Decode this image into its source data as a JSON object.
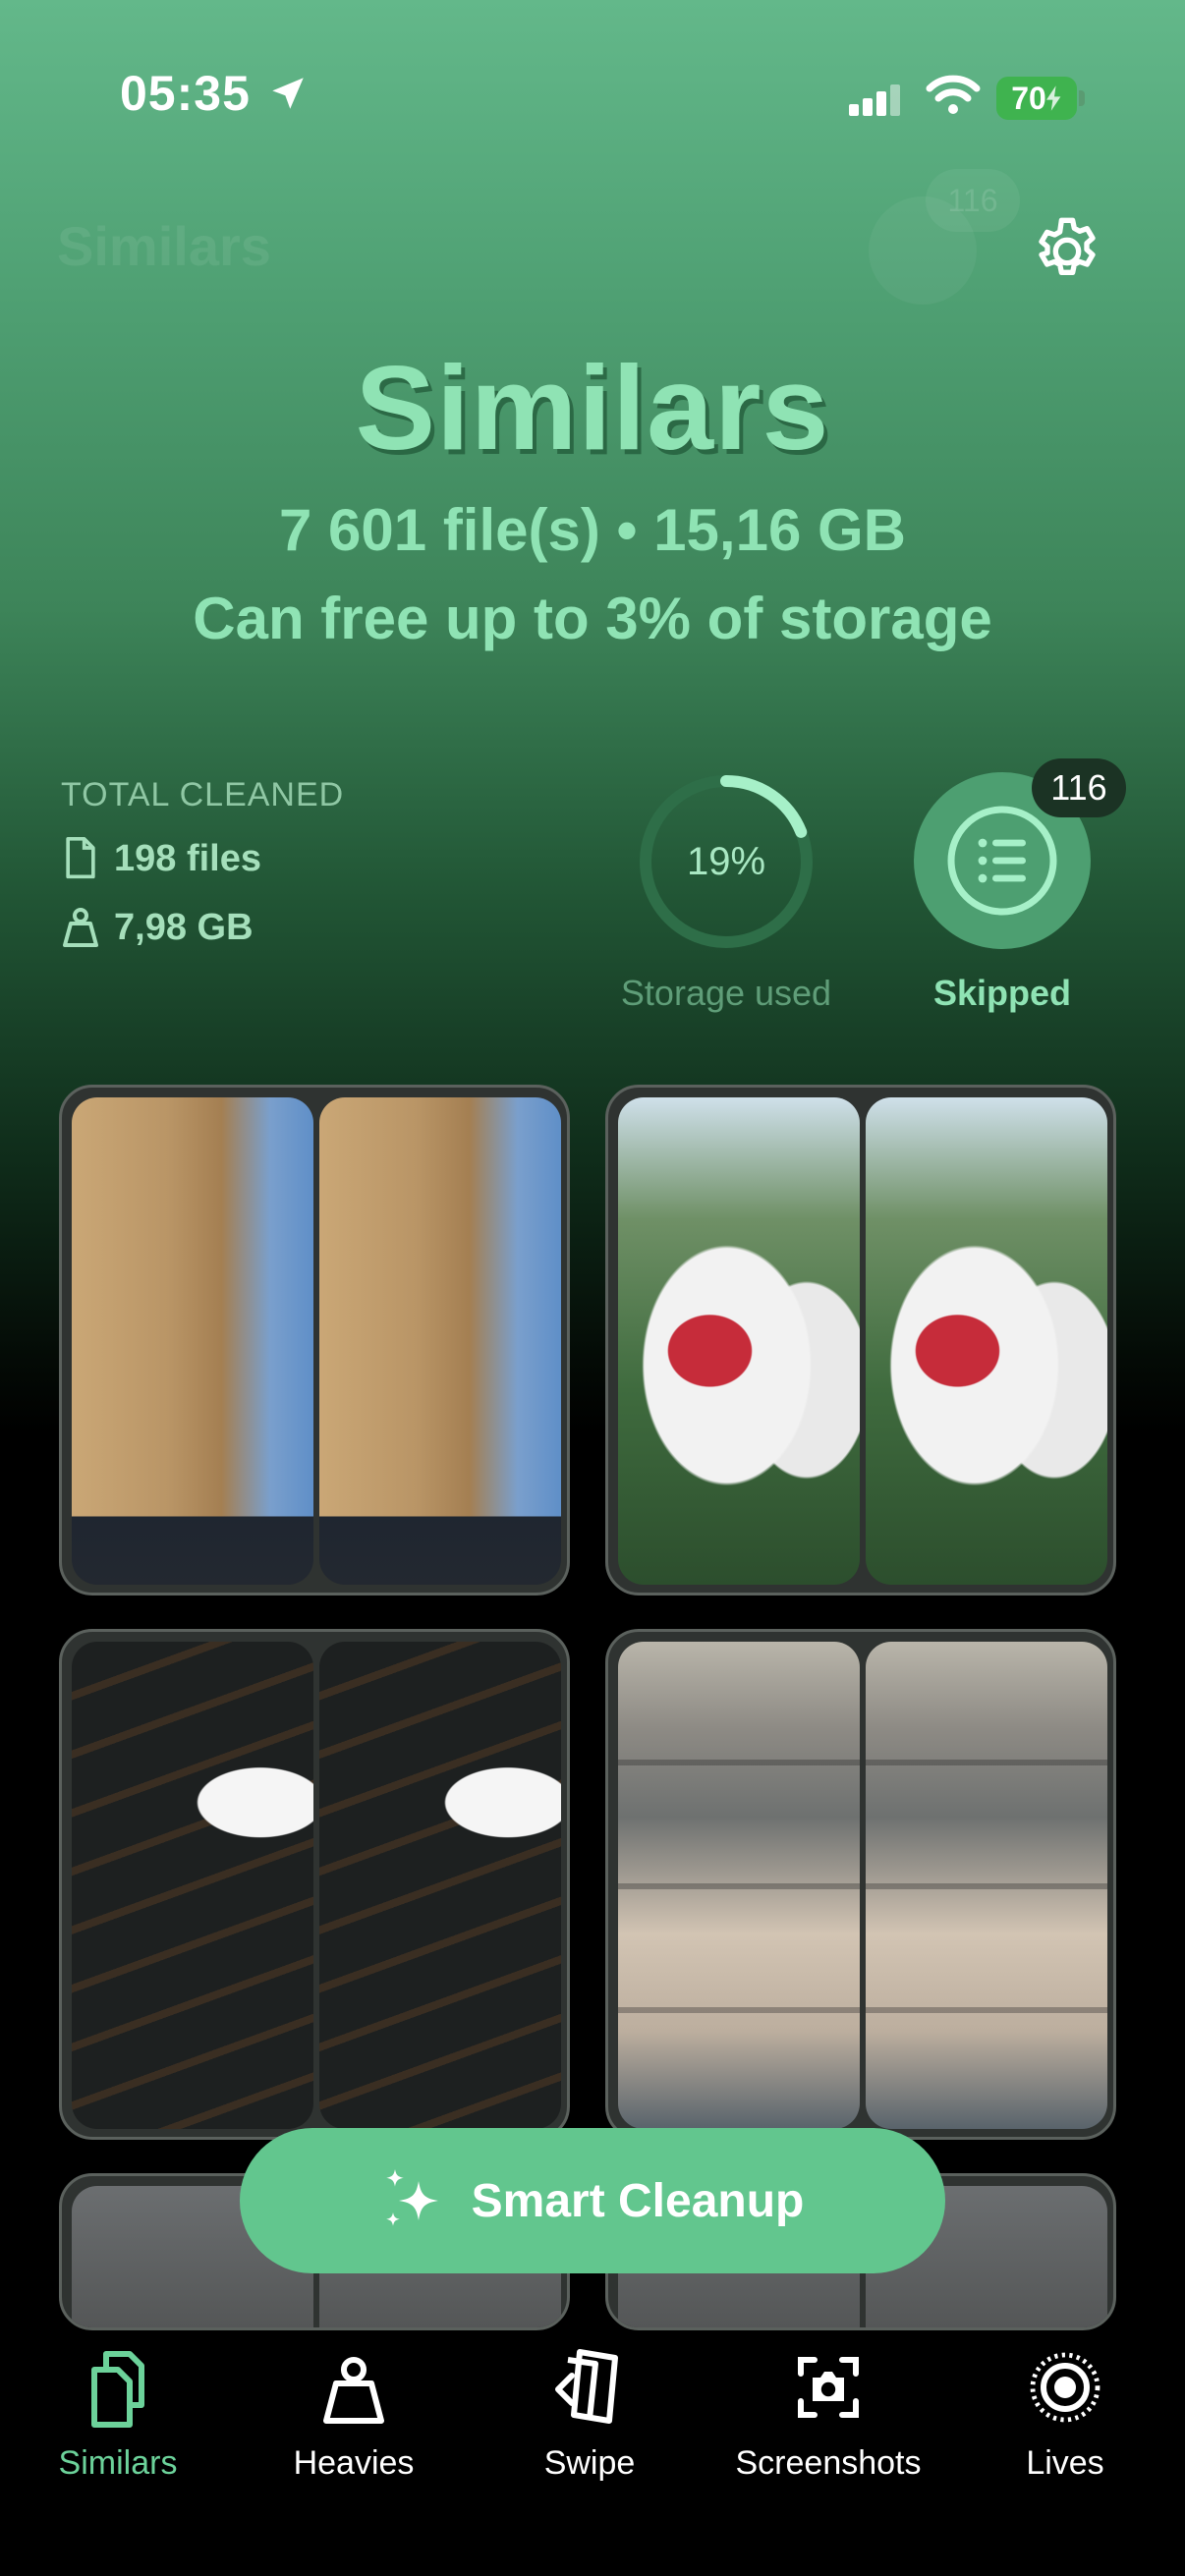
{
  "status_bar": {
    "time": "05:35",
    "battery": "70"
  },
  "header": {
    "ghost_title": "Similars",
    "ghost_badge": "116"
  },
  "hero": {
    "title": "Similars",
    "files_summary": "7 601 file(s) • 15,16 GB",
    "free_up": "Can free up to 3% of storage"
  },
  "total_cleaned": {
    "label": "TOTAL CLEANED",
    "files": "198 files",
    "size": "7,98 GB"
  },
  "storage": {
    "percent_text": "19%",
    "fraction": 0.19,
    "label": "Storage used"
  },
  "skipped": {
    "count": "116",
    "label": "Skipped"
  },
  "grid": {
    "items": [
      {
        "name": "arc-de-triomphe-pair"
      },
      {
        "name": "korean-flag-pair"
      },
      {
        "name": "kimbap-pair"
      },
      {
        "name": "building-window-pair"
      }
    ]
  },
  "cleanup": {
    "label": "Smart Cleanup"
  },
  "tabs": [
    {
      "label": "Similars",
      "icon": "documents-icon",
      "active": true
    },
    {
      "label": "Heavies",
      "icon": "weight-icon",
      "active": false
    },
    {
      "label": "Swipe",
      "icon": "swipe-cards-icon",
      "active": false
    },
    {
      "label": "Screenshots",
      "icon": "screenshot-camera-icon",
      "active": false
    },
    {
      "label": "Lives",
      "icon": "live-photo-icon",
      "active": false
    }
  ],
  "colors": {
    "accent": "#62c68e",
    "hero_text": "#8fe3b4",
    "active_tab": "#6cd29a"
  }
}
